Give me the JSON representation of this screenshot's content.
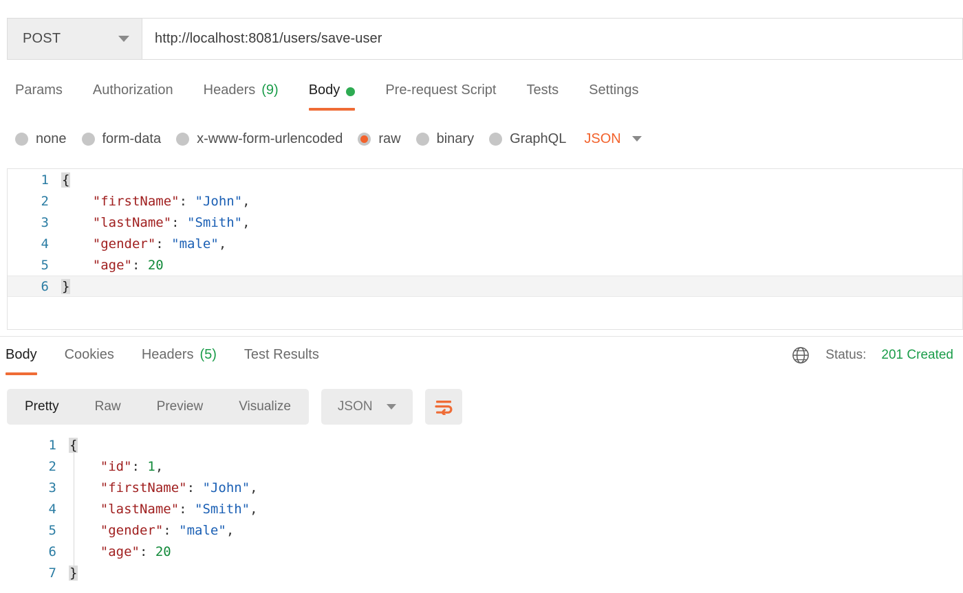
{
  "request": {
    "method": "POST",
    "url": "http://localhost:8081/users/save-user",
    "tabs": [
      {
        "label": "Params",
        "active": false
      },
      {
        "label": "Authorization",
        "active": false
      },
      {
        "label": "Headers",
        "count": "(9)",
        "active": false
      },
      {
        "label": "Body",
        "active": true,
        "dot": "green-dot"
      },
      {
        "label": "Pre-request Script",
        "active": false
      },
      {
        "label": "Tests",
        "active": false
      },
      {
        "label": "Settings",
        "active": false
      }
    ],
    "body_types": [
      {
        "label": "none",
        "selected": false
      },
      {
        "label": "form-data",
        "selected": false
      },
      {
        "label": "x-www-form-urlencoded",
        "selected": false
      },
      {
        "label": "raw",
        "selected": true
      },
      {
        "label": "binary",
        "selected": false
      },
      {
        "label": "GraphQL",
        "selected": false
      }
    ],
    "language": "JSON",
    "body_lines": [
      {
        "num": "1",
        "tokens": [
          {
            "t": "{",
            "c": "brace"
          }
        ]
      },
      {
        "num": "2",
        "tokens": [
          {
            "t": "    ",
            "c": "p"
          },
          {
            "t": "\"firstName\"",
            "c": "k"
          },
          {
            "t": ": ",
            "c": "p"
          },
          {
            "t": "\"John\"",
            "c": "s"
          },
          {
            "t": ",",
            "c": "p"
          }
        ]
      },
      {
        "num": "3",
        "tokens": [
          {
            "t": "    ",
            "c": "p"
          },
          {
            "t": "\"lastName\"",
            "c": "k"
          },
          {
            "t": ": ",
            "c": "p"
          },
          {
            "t": "\"Smith\"",
            "c": "s"
          },
          {
            "t": ",",
            "c": "p"
          }
        ]
      },
      {
        "num": "4",
        "tokens": [
          {
            "t": "    ",
            "c": "p"
          },
          {
            "t": "\"gender\"",
            "c": "k"
          },
          {
            "t": ": ",
            "c": "p"
          },
          {
            "t": "\"male\"",
            "c": "s"
          },
          {
            "t": ",",
            "c": "p"
          }
        ]
      },
      {
        "num": "5",
        "tokens": [
          {
            "t": "    ",
            "c": "p"
          },
          {
            "t": "\"age\"",
            "c": "k"
          },
          {
            "t": ": ",
            "c": "p"
          },
          {
            "t": "20",
            "c": "n"
          }
        ]
      },
      {
        "num": "6",
        "active": true,
        "tokens": [
          {
            "t": "}",
            "c": "brace"
          }
        ]
      }
    ]
  },
  "response": {
    "tabs": [
      {
        "label": "Body",
        "active": true
      },
      {
        "label": "Cookies",
        "active": false
      },
      {
        "label": "Headers",
        "count": "(5)",
        "active": false
      },
      {
        "label": "Test Results",
        "active": false
      }
    ],
    "status_label": "Status:",
    "status_value": "201 Created",
    "views": [
      {
        "label": "Pretty",
        "active": true
      },
      {
        "label": "Raw",
        "active": false
      },
      {
        "label": "Preview",
        "active": false
      },
      {
        "label": "Visualize",
        "active": false
      }
    ],
    "language": "JSON",
    "body_lines": [
      {
        "num": "1",
        "tokens": [
          {
            "t": "{",
            "c": "brace"
          }
        ]
      },
      {
        "num": "2",
        "tokens": [
          {
            "t": "    ",
            "c": "p"
          },
          {
            "t": "\"id\"",
            "c": "k"
          },
          {
            "t": ": ",
            "c": "p"
          },
          {
            "t": "1",
            "c": "n"
          },
          {
            "t": ",",
            "c": "p"
          }
        ]
      },
      {
        "num": "3",
        "tokens": [
          {
            "t": "    ",
            "c": "p"
          },
          {
            "t": "\"firstName\"",
            "c": "k"
          },
          {
            "t": ": ",
            "c": "p"
          },
          {
            "t": "\"John\"",
            "c": "s"
          },
          {
            "t": ",",
            "c": "p"
          }
        ]
      },
      {
        "num": "4",
        "tokens": [
          {
            "t": "    ",
            "c": "p"
          },
          {
            "t": "\"lastName\"",
            "c": "k"
          },
          {
            "t": ": ",
            "c": "p"
          },
          {
            "t": "\"Smith\"",
            "c": "s"
          },
          {
            "t": ",",
            "c": "p"
          }
        ]
      },
      {
        "num": "5",
        "tokens": [
          {
            "t": "    ",
            "c": "p"
          },
          {
            "t": "\"gender\"",
            "c": "k"
          },
          {
            "t": ": ",
            "c": "p"
          },
          {
            "t": "\"male\"",
            "c": "s"
          },
          {
            "t": ",",
            "c": "p"
          }
        ]
      },
      {
        "num": "6",
        "tokens": [
          {
            "t": "    ",
            "c": "p"
          },
          {
            "t": "\"age\"",
            "c": "k"
          },
          {
            "t": ": ",
            "c": "p"
          },
          {
            "t": "20",
            "c": "n"
          }
        ]
      },
      {
        "num": "7",
        "tokens": [
          {
            "t": "}",
            "c": "brace"
          }
        ]
      }
    ]
  },
  "colors": {
    "accent_orange": "#ef6c36",
    "status_green": "#1a9c49",
    "json_key": "#a02020",
    "json_string": "#1a5fb4",
    "json_number": "#128a3a",
    "line_number": "#2a7ca3"
  }
}
